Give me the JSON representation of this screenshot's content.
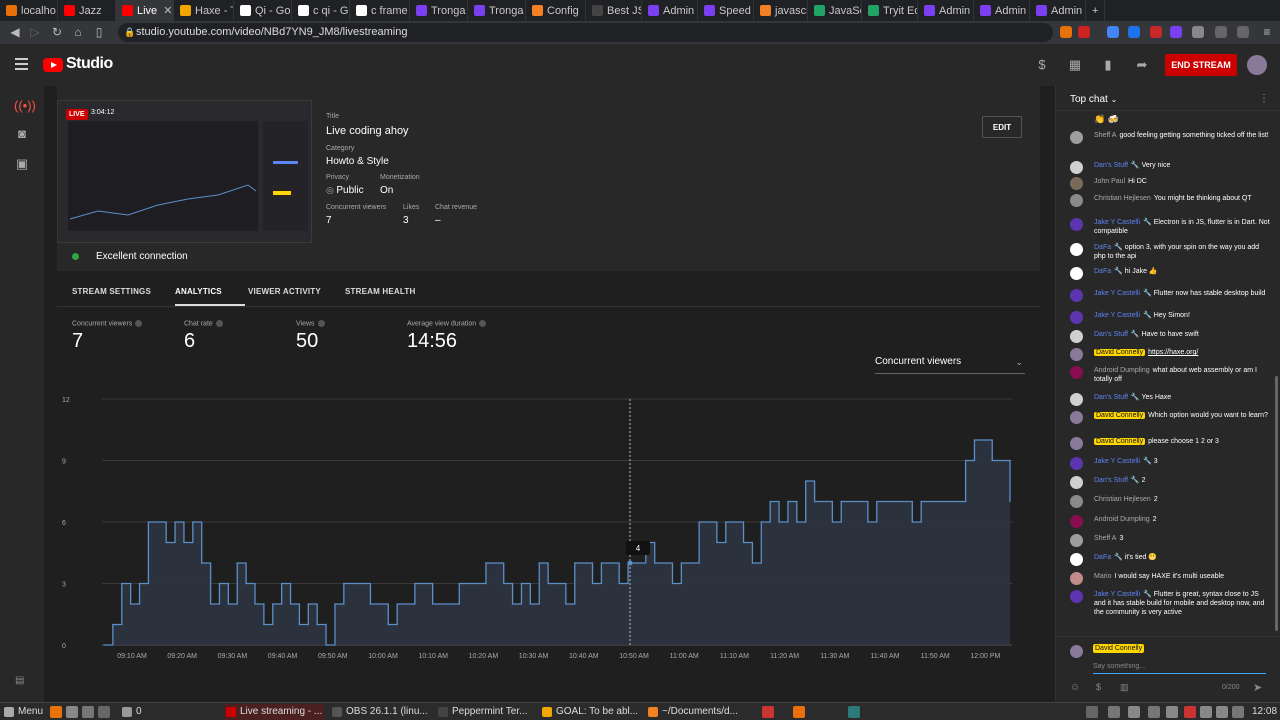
{
  "browser": {
    "tabs": [
      {
        "label": "localho",
        "color": "#e8710a"
      },
      {
        "label": "Jazz",
        "color": "#ff0000"
      },
      {
        "label": "Live",
        "color": "#ff0000",
        "active": true
      },
      {
        "label": "Haxe - T",
        "color": "#f1a600"
      },
      {
        "label": "Qi - Goo",
        "color": "#ffffff"
      },
      {
        "label": "c qi - Go",
        "color": "#ffffff"
      },
      {
        "label": "c frame",
        "color": "#ffffff"
      },
      {
        "label": "Tronga",
        "color": "#7b3ff2"
      },
      {
        "label": "Tronga",
        "color": "#7b3ff2"
      },
      {
        "label": "Config",
        "color": "#f48024"
      },
      {
        "label": "Best JS",
        "color": "#444444"
      },
      {
        "label": "Admin",
        "color": "#7b3ff2"
      },
      {
        "label": "Speed C",
        "color": "#7b3ff2"
      },
      {
        "label": "javascri",
        "color": "#f48024"
      },
      {
        "label": "JavaSc",
        "color": "#21a366"
      },
      {
        "label": "Tryit Ed",
        "color": "#21a366"
      },
      {
        "label": "Admin",
        "color": "#7b3ff2"
      },
      {
        "label": "Admin",
        "color": "#7b3ff2"
      },
      {
        "label": "Admin",
        "color": "#7b3ff2"
      }
    ],
    "url": "studio.youtube.com/video/NBd7YN9_JM8/livestreaming"
  },
  "header": {
    "brand": "Studio",
    "end_stream_label": "END STREAM"
  },
  "stream": {
    "live_badge": "LIVE",
    "elapsed": "3:04:12",
    "title_label": "Title",
    "title": "Live coding ahoy",
    "category_label": "Category",
    "category": "Howto & Style",
    "privacy_label": "Privacy",
    "privacy": "Public",
    "monetization_label": "Monetization",
    "monetization": "On",
    "concurrent_label": "Concurrent viewers",
    "concurrent": "7",
    "likes_label": "Likes",
    "likes": "3",
    "revenue_label": "Chat revenue",
    "revenue": "–",
    "edit_label": "EDIT",
    "connection": "Excellent connection"
  },
  "tabs": {
    "settings": "STREAM SETTINGS",
    "analytics": "ANALYTICS",
    "viewer_activity": "VIEWER ACTIVITY",
    "health": "STREAM HEALTH"
  },
  "stats": [
    {
      "label": "Concurrent viewers",
      "value": "7"
    },
    {
      "label": "Chat rate",
      "value": "6"
    },
    {
      "label": "Views",
      "value": "50"
    },
    {
      "label": "Average view duration",
      "value": "14:56"
    }
  ],
  "metric_select": "Concurrent viewers",
  "chart_data": {
    "type": "area",
    "ylim": [
      0,
      12
    ],
    "yticks": [
      "0",
      "3",
      "6",
      "9",
      "12"
    ],
    "xticks": [
      "09:10 AM",
      "09:20 AM",
      "09:30 AM",
      "09:40 AM",
      "09:50 AM",
      "10:00 AM",
      "10:10 AM",
      "10:20 AM",
      "10:30 AM",
      "10:40 AM",
      "10:50 AM",
      "11:00 AM",
      "11:10 AM",
      "11:20 AM",
      "11:30 AM",
      "11:40 AM",
      "11:50 AM",
      "12:00 PM"
    ],
    "series": [
      {
        "values": [
          0,
          1,
          3,
          2,
          3,
          6,
          6,
          5,
          6,
          5,
          6,
          4,
          2,
          3,
          2,
          4,
          3,
          2,
          1,
          2,
          3,
          2,
          1,
          2,
          1,
          0,
          2,
          3,
          3,
          3,
          2,
          2,
          1,
          2,
          2,
          3,
          3,
          2,
          2,
          2,
          3,
          3,
          3,
          4,
          4,
          3,
          2,
          3,
          2,
          4,
          3,
          3,
          2,
          4,
          4,
          3,
          4,
          4,
          3,
          4,
          4,
          5,
          4,
          4,
          3,
          4,
          4,
          6,
          6,
          5,
          6,
          6,
          5,
          4,
          6,
          7,
          6,
          7,
          6,
          8,
          7,
          7,
          6,
          7,
          7,
          7,
          6,
          7,
          7,
          7,
          7,
          6,
          7,
          7,
          7,
          7,
          7,
          9,
          10,
          10,
          9,
          9,
          7
        ]
      }
    ],
    "hover_value": "4"
  },
  "chat": {
    "title": "Top chat",
    "messages": [
      {
        "author": "Sheff A",
        "text": "good feeling getting something ticked off the list!",
        "role": "normal",
        "color": "#9e9e9e"
      },
      {
        "author": "Dan's Stuff",
        "text": "Very nice",
        "role": "mod",
        "color": "#d0d0d0"
      },
      {
        "author": "John Paul",
        "text": "Hi DC",
        "role": "normal",
        "color": "#7a6a5a"
      },
      {
        "author": "Christian Hejlesen",
        "text": "You might be thinking about QT",
        "role": "normal",
        "color": "#8a8a8a"
      },
      {
        "author": "Jake Y Castelli",
        "text": "Electron is in JS, flutter is in Dart. Not compatible",
        "role": "mod",
        "color": "#5e35b1"
      },
      {
        "author": "DaFa",
        "text": "option 3, with your spin on the way you add php to the api",
        "role": "mod",
        "color": "#ffffff"
      },
      {
        "author": "DaFa",
        "text": "hi Jake 👍",
        "role": "mod",
        "color": "#ffffff"
      },
      {
        "author": "Jake Y Castelli",
        "text": "Flutter now has stable desktop build",
        "role": "mod",
        "color": "#5e35b1"
      },
      {
        "author": "Jake Y Castelli",
        "text": "Hey Simon!",
        "role": "mod",
        "color": "#5e35b1"
      },
      {
        "author": "Dan's Stuff",
        "text": "Have to have swift",
        "role": "mod",
        "color": "#d0d0d0"
      },
      {
        "author": "David Connelly",
        "text": "https://haxe.org/",
        "role": "owner",
        "color": "#8a7a9a",
        "link": true
      },
      {
        "author": "Android Dumpling",
        "text": "what about web assembly or am I totally off",
        "role": "normal",
        "color": "#880e4f"
      },
      {
        "author": "Dan's Stuff",
        "text": "Yes Haxe",
        "role": "mod",
        "color": "#d0d0d0"
      },
      {
        "author": "David Connelly",
        "text": "Which option would you want to learn?",
        "role": "owner",
        "color": "#8a7a9a"
      },
      {
        "author": "David Connelly",
        "text": "please choose 1 2 or 3",
        "role": "owner",
        "color": "#8a7a9a"
      },
      {
        "author": "Jake Y Castelli",
        "text": "3",
        "role": "mod",
        "color": "#5e35b1"
      },
      {
        "author": "Dan's Stuff",
        "text": "2",
        "role": "mod",
        "color": "#d0d0d0"
      },
      {
        "author": "Christian Hejlesen",
        "text": "2",
        "role": "normal",
        "color": "#8a8a8a"
      },
      {
        "author": "Android Dumpling",
        "text": "2",
        "role": "normal",
        "color": "#880e4f"
      },
      {
        "author": "Sheff A",
        "text": "3",
        "role": "normal",
        "color": "#9e9e9e"
      },
      {
        "author": "DaFa",
        "text": "it's tied 😬",
        "role": "mod",
        "color": "#ffffff"
      },
      {
        "author": "Mario",
        "text": "I would say HAXE it's multi useable",
        "role": "normal",
        "color": "#c48b8b"
      },
      {
        "author": "Jake Y Castelli",
        "text": "Flutter is great, syntax close to JS and it has stable build for mobile and desktop now, and the community is very active",
        "role": "mod",
        "color": "#5e35b1"
      }
    ],
    "composer_author": "David Connelly",
    "composer_placeholder": "Say something...",
    "char_count": "0/200"
  },
  "taskbar": {
    "menu": "Menu",
    "workspace": "0",
    "items": [
      {
        "label": "Live streaming - ...",
        "color": "#cc0000",
        "active": true
      },
      {
        "label": "OBS 26.1.1 (linu...",
        "color": "#555555"
      },
      {
        "label": "Peppermint Ter...",
        "color": "#444444"
      },
      {
        "label": "GOAL: To be abl...",
        "color": "#f1a600"
      },
      {
        "label": "~/Documents/d...",
        "color": "#f48024"
      }
    ],
    "clock": "12:08"
  }
}
